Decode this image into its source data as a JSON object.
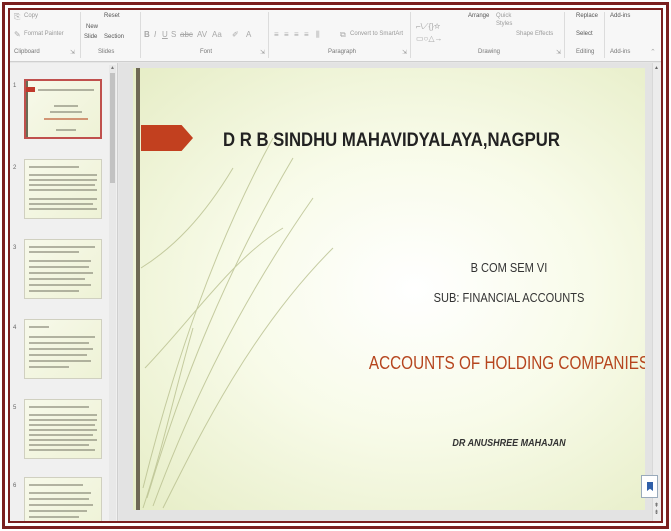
{
  "ribbon": {
    "groups": [
      {
        "label": "Clipboard"
      },
      {
        "label": "Slides"
      },
      {
        "label": "Font"
      },
      {
        "label": "Paragraph"
      },
      {
        "label": "Drawing"
      },
      {
        "label": "Editing"
      },
      {
        "label": "Add-ins"
      }
    ],
    "copy_label": "Copy",
    "format_painter_label": "Format Painter",
    "new_slide_label": "New",
    "new_slide_label2": "Slide",
    "reset_label": "Reset",
    "section_label": "Section",
    "convert_smartart_label": "Convert to SmartArt",
    "arrange_label": "Arrange",
    "quick_styles_label": "Quick",
    "quick_styles_label2": "Styles",
    "shape_effects_label": "Shape Effects",
    "replace_label": "Replace",
    "select_label": "Select",
    "addins_label": "Add-ins"
  },
  "thumbnails": [
    {
      "num": "1"
    },
    {
      "num": "2"
    },
    {
      "num": "3"
    },
    {
      "num": "4"
    },
    {
      "num": "5"
    },
    {
      "num": "6"
    }
  ],
  "slide": {
    "title": "D R B SINDHU MAHAVIDYALAYA,NAGPUR",
    "subtitle1": "B COM SEM VI",
    "subtitle2": "SUB: FINANCIAL ACCOUNTS",
    "heading": "ACCOUNTS OF HOLDING COMPANIES",
    "author": "DR ANUSHREE MAHAJAN"
  },
  "colors": {
    "frame": "#7b1f1f",
    "accent_red": "#c2401f",
    "heading_color": "#b6451e",
    "slide_bg": "#f4f8e4"
  }
}
